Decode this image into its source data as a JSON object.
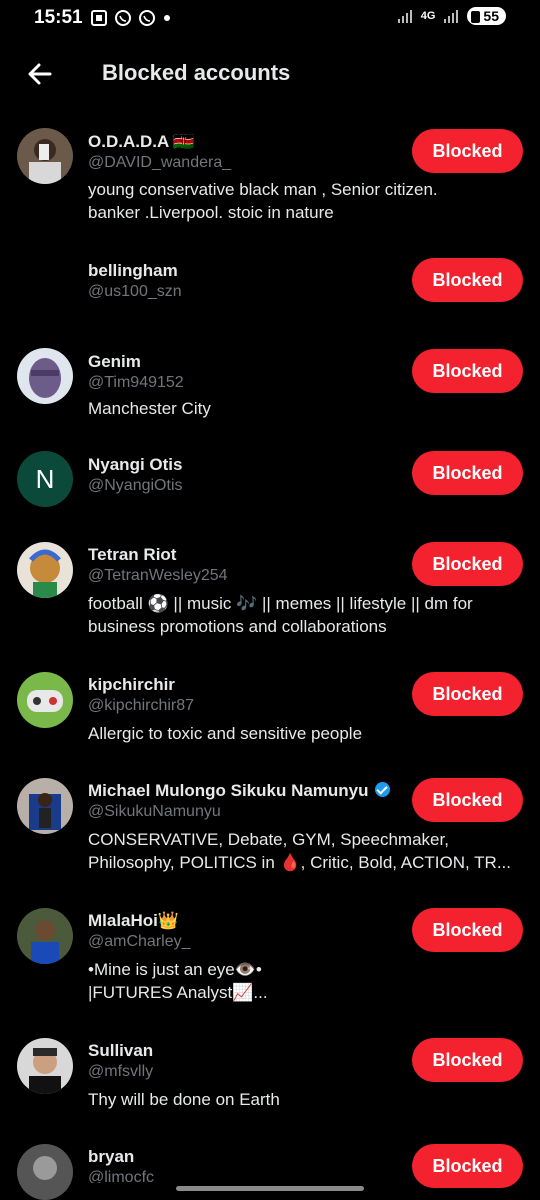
{
  "status_bar": {
    "time": "15:51",
    "battery": "55",
    "network": "4G"
  },
  "header": {
    "title": "Blocked accounts"
  },
  "button_label": "Blocked",
  "accounts": [
    {
      "name": "O.D.A.D.A 🇰🇪",
      "handle": "@DAVID_wandera_",
      "bio": [
        "young conservative black man , Senior citizen.",
        "banker .Liverpool. stoic in nature"
      ],
      "avatar": "photo"
    },
    {
      "name": "bellingham",
      "handle": "@us100_szn",
      "bio": [],
      "avatar": "none"
    },
    {
      "name": "Genim",
      "handle": "@Tim949152",
      "bio": [
        "Manchester City"
      ],
      "avatar": "photo"
    },
    {
      "name": "Nyangi Otis",
      "handle": "@NyangiOtis",
      "bio": [],
      "avatar": "initial",
      "initial": "N"
    },
    {
      "name": "Tetran Riot",
      "handle": "@TetranWesley254",
      "bio": [
        "football ⚽ || music 🎶 || memes || lifestyle || dm for",
        "business promotions and collaborations"
      ],
      "avatar": "photo"
    },
    {
      "name": "kipchirchir",
      "handle": "@kipchirchir87",
      "bio": [
        "Allergic to toxic and sensitive  people"
      ],
      "avatar": "photo"
    },
    {
      "name": "Michael Mulongo Sikuku Namunyu",
      "handle": "@SikukuNamunyu",
      "bio": [
        "CONSERVATIVE, Debate, GYM, Speechmaker,",
        "Philosophy, POLITICS in 🩸, Critic, Bold, ACTION, TR..."
      ],
      "avatar": "photo",
      "verified": true
    },
    {
      "name": "MlalaHoi👑",
      "handle": "@amCharley_",
      "bio": [
        "•Mine is just an eye👁️•",
        "|FUTURES Analyst📈..."
      ],
      "avatar": "photo"
    },
    {
      "name": "Sullivan",
      "handle": "@mfsvlly",
      "bio": [
        "Thy will be done on Earth"
      ],
      "avatar": "photo"
    },
    {
      "name": "bryan",
      "handle": "@limocfc",
      "bio": [],
      "avatar": "photo"
    }
  ],
  "colors": {
    "background": "#000000",
    "accent_red": "#f4212e",
    "secondary_text": "#71767b",
    "initial_avatar_bg": "#0b4a3a"
  }
}
